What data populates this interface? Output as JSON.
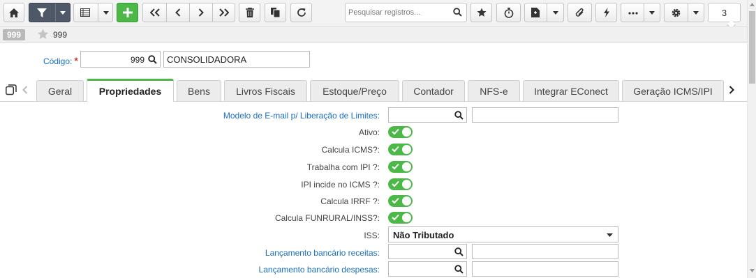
{
  "toolbar": {
    "buttons": [
      "home-icon",
      "filter-icon",
      "list-view-icon",
      "add-icon",
      "first-record-icon",
      "previous-record-icon",
      "next-record-icon",
      "last-record-icon",
      "delete-icon",
      "copy-icon",
      "refresh-icon",
      "favorite-icon",
      "timer-icon",
      "report-icon",
      "attachment-icon",
      "action-icon",
      "more-icon",
      "settings-icon"
    ],
    "search_placeholder": "Pesquisar registros...",
    "record_count": "3"
  },
  "record_bar": {
    "badge": "999",
    "id": "999"
  },
  "codigo": {
    "label": "Código:",
    "required_mark": "*",
    "value": "999",
    "description": "CONSOLIDADORA"
  },
  "tabs": [
    "Geral",
    "Propriedades",
    "Bens",
    "Livros Fiscais",
    "Estoque/Preço",
    "Contador",
    "NFS-e",
    "Integrar EConect",
    "Geração ICMS/IPI"
  ],
  "active_tab": "Propriedades",
  "form": {
    "modelo_email_label": "Modelo de E-mail p/ Liberação de Limites:",
    "toggles": [
      {
        "label": "Ativo:",
        "on": true
      },
      {
        "label": "Calcula ICMS?:",
        "on": true
      },
      {
        "label": "Trabalha com IPI ?:",
        "on": true
      },
      {
        "label": "IPI incide no ICMS ?:",
        "on": true
      },
      {
        "label": "Calcula IRRF ?:",
        "on": true
      },
      {
        "label": "Calcula FUNRURAL/INSS?:",
        "on": true
      }
    ],
    "iss_label": "ISS:",
    "iss_value": "Não Tributado",
    "lanc_receitas_label": "Lançamento bancário receitas:",
    "lanc_despesas_label": "Lançamento bancário despesas:"
  },
  "colors": {
    "accent_green": "#4cb848",
    "link_blue": "#1a6fc4",
    "required_red": "#d9362b"
  }
}
